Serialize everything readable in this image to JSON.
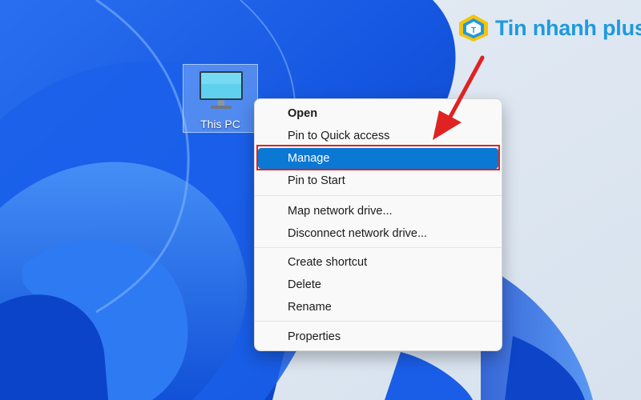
{
  "desktop": {
    "icon": {
      "name": "This PC",
      "icon": "monitor-icon"
    }
  },
  "brand": {
    "name": "Tin nhanh plus",
    "logo_letter": "T",
    "color": "#1d9ae0"
  },
  "context_menu": {
    "items": [
      {
        "label": "Open",
        "bold": true
      },
      {
        "label": "Pin to Quick access"
      },
      {
        "label": "Manage",
        "highlighted": true
      },
      {
        "label": "Pin to Start"
      },
      {
        "label": "Map network drive..."
      },
      {
        "label": "Disconnect network drive..."
      },
      {
        "label": "Create shortcut"
      },
      {
        "label": "Delete"
      },
      {
        "label": "Rename"
      },
      {
        "label": "Properties"
      }
    ],
    "accent_color": "#0b78d4"
  },
  "annotation": {
    "color": "#e02222",
    "target": "Manage"
  }
}
